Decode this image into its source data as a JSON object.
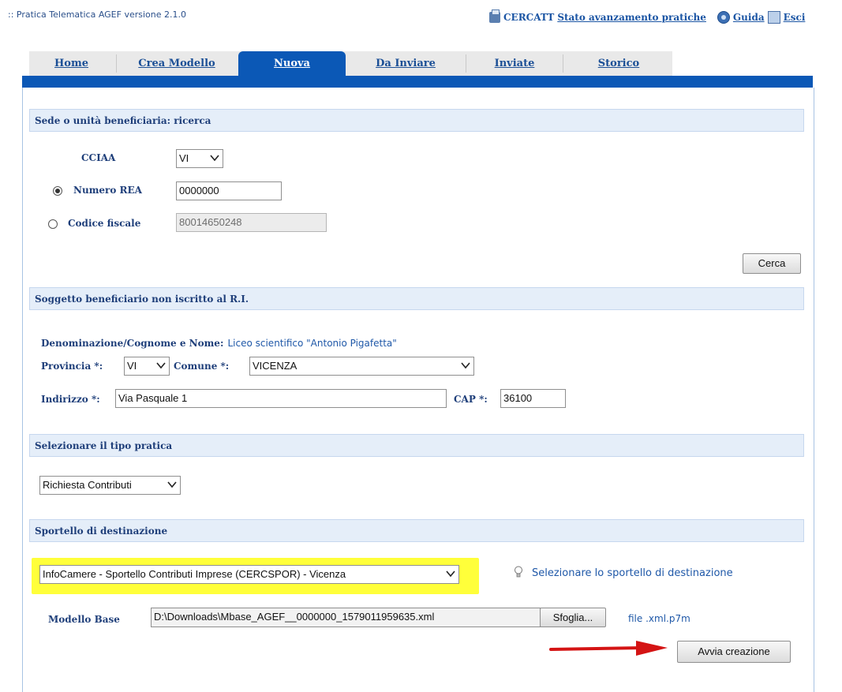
{
  "header": {
    "app_title": ":: Pratica Telematica AGEF versione 2.1.0",
    "cercatt": "CERCATT",
    "stato": "Stato avanzamento pratiche",
    "guida": "Guida",
    "esci": "Esci"
  },
  "tabs": [
    {
      "label": "Home"
    },
    {
      "label": "Crea Modello"
    },
    {
      "label": "Nuova"
    },
    {
      "label": "Da Inviare"
    },
    {
      "label": "Inviate"
    },
    {
      "label": "Storico"
    }
  ],
  "ricerca": {
    "title": "Sede o unità beneficiaria: ricerca",
    "cciaa_label": "CCIAA",
    "cciaa_value": "VI",
    "rea_label": "Numero REA",
    "rea_value": "0000000",
    "cf_label": "Codice fiscale",
    "cf_value": "80014650248",
    "search_button": "Cerca"
  },
  "soggetto": {
    "title": "Soggetto beneficiario non iscritto al R.I.",
    "denominazione_label": "Denominazione/Cognome e Nome:",
    "denominazione_value": "Liceo scientifico \"Antonio Pigafetta\"",
    "provincia_label": "Provincia *:",
    "provincia_value": "VI",
    "comune_label": "Comune *:",
    "comune_value": "VICENZA",
    "indirizzo_label": "Indirizzo *:",
    "indirizzo_value": "Via Pasquale 1",
    "cap_label": "CAP *:",
    "cap_value": "36100"
  },
  "tipo_pratica": {
    "title": "Selezionare il tipo pratica",
    "value": "Richiesta Contributi"
  },
  "sportello": {
    "title": "Sportello di destinazione",
    "value": "InfoCamere - Sportello Contributi Imprese (CERCSPOR) - Vicenza",
    "hint": "Selezionare lo sportello di destinazione",
    "modello_label": "Modello Base",
    "modello_value": "D:\\Downloads\\Mbase_AGEF__0000000_1579011959635.xml",
    "browse_button": "Sfoglia...",
    "file_ext": "file .xml.p7m",
    "start_button": "Avvia creazione"
  },
  "colors": {
    "accent": "#0b58b6",
    "section_bg": "#e5eef9",
    "highlight": "#ffff3a",
    "arrow": "#d41414"
  }
}
